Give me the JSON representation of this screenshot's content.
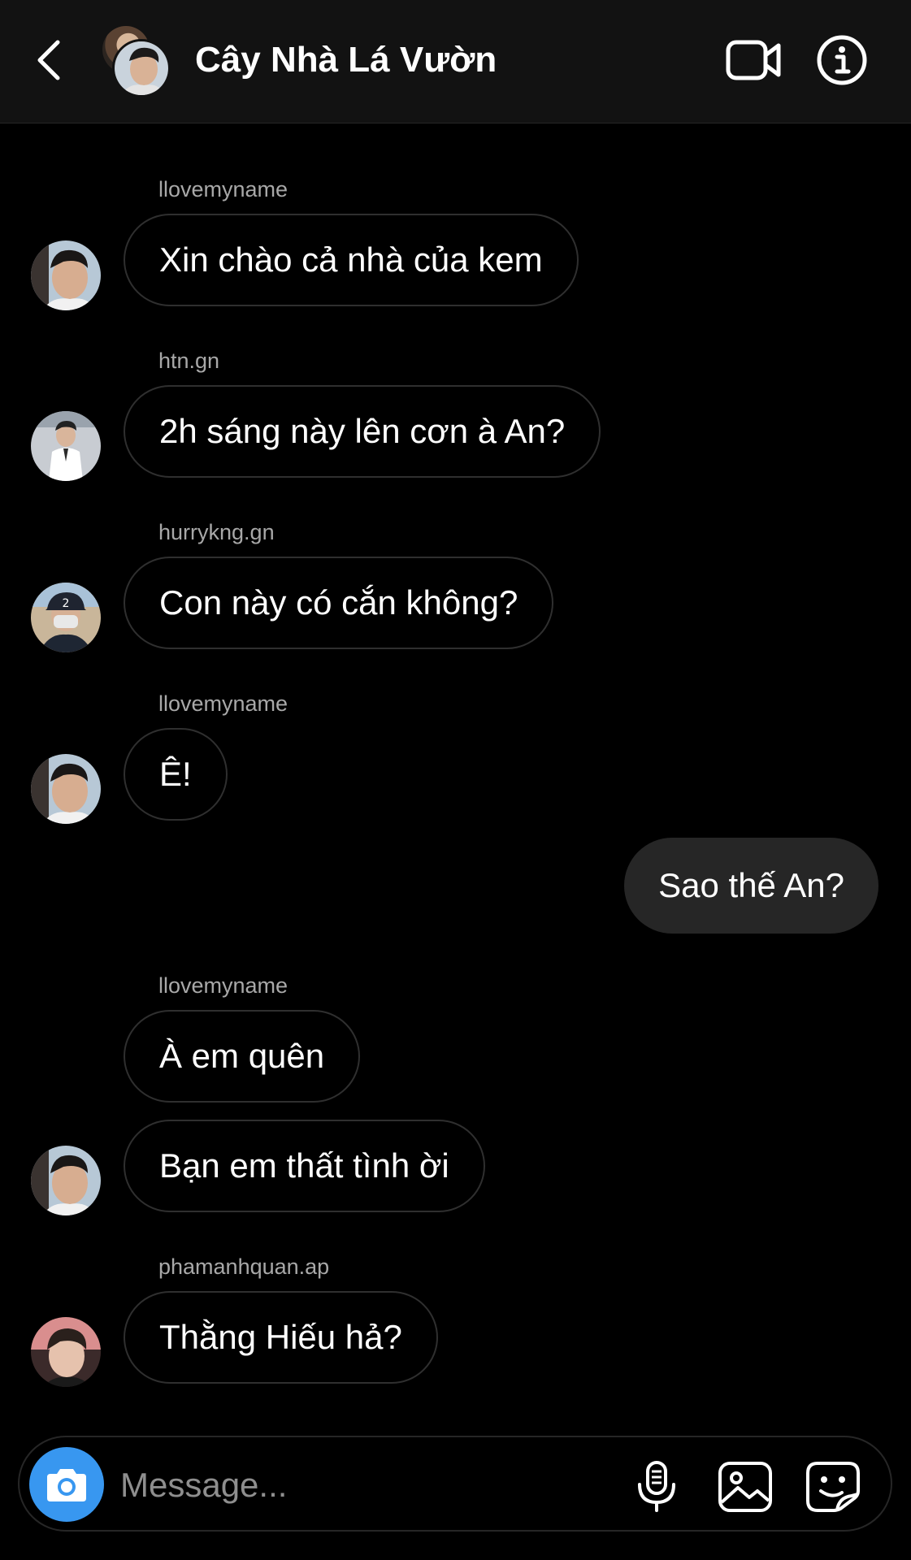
{
  "header": {
    "title": "Cây Nhà Lá Vườn",
    "back_icon": "chevron-left-icon",
    "video_icon": "video-camera-icon",
    "info_icon": "info-icon"
  },
  "messages": [
    {
      "sender": "llovemyname",
      "text": "Xin chào cả nhà của kem",
      "direction": "incoming"
    },
    {
      "sender": "htn.gn",
      "text": "2h sáng này lên cơn à An?",
      "direction": "incoming"
    },
    {
      "sender": "hurrykng.gn",
      "text": "Con này có cắn không?",
      "direction": "incoming"
    },
    {
      "sender": "llovemyname",
      "text": "Ê!",
      "direction": "incoming"
    },
    {
      "sender": "",
      "text": "Sao thế An?",
      "direction": "outgoing"
    },
    {
      "sender": "llovemyname",
      "text": "À em quên",
      "direction": "incoming"
    },
    {
      "sender": "",
      "text": "Bạn em thất tình ời",
      "direction": "incoming"
    },
    {
      "sender": "phamanhquan.ap",
      "text": "Thằng Hiếu hả?",
      "direction": "incoming"
    }
  ],
  "composer": {
    "placeholder": "Message...",
    "value": "",
    "camera_icon": "camera-icon",
    "mic_icon": "microphone-icon",
    "gallery_icon": "gallery-icon",
    "sticker_icon": "sticker-icon"
  },
  "colors": {
    "background": "#000000",
    "header_bg": "#121212",
    "outgoing_bubble": "#262626",
    "bubble_border": "#2f2f2f",
    "sender_text": "#a8a8a8",
    "accent": "#3897f0"
  }
}
